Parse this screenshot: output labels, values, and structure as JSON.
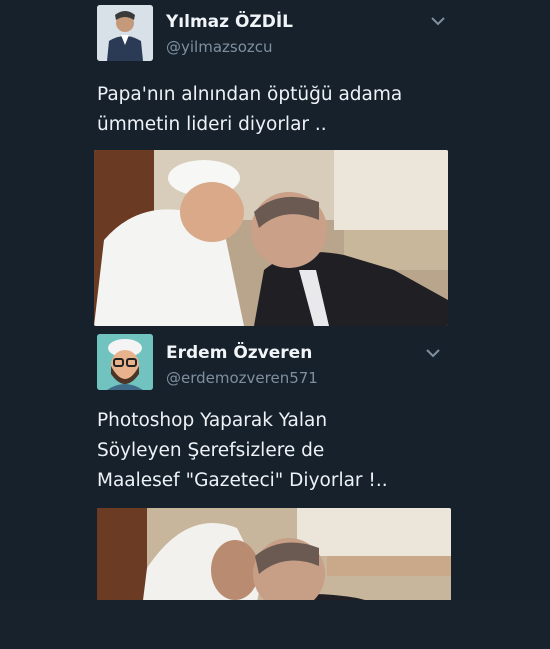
{
  "tweets": [
    {
      "name": "Yılmaz ÖZDİL",
      "handle": "@yilmazsozcu",
      "text_lines": [
        "Papa'nın alnından öptüğü adama",
        "ümmetin lideri diyorlar .."
      ],
      "avatar_icon": "profile-photo",
      "menu_icon": "chevron-down-icon"
    },
    {
      "name": "Erdem Özveren",
      "handle": "@erdemozveren571",
      "text_lines": [
        "Photoshop Yaparak Yalan",
        "Söyleyen Şerefsizlere de",
        "Maalesef \"Gazeteci\" Diyorlar !.."
      ],
      "avatar_icon": "cartoon-avatar",
      "menu_icon": "chevron-down-icon"
    }
  ],
  "colors": {
    "background": "#16212c",
    "name": "#f2f5f8",
    "handle": "#7f8f9e",
    "text": "#eef2f6"
  }
}
